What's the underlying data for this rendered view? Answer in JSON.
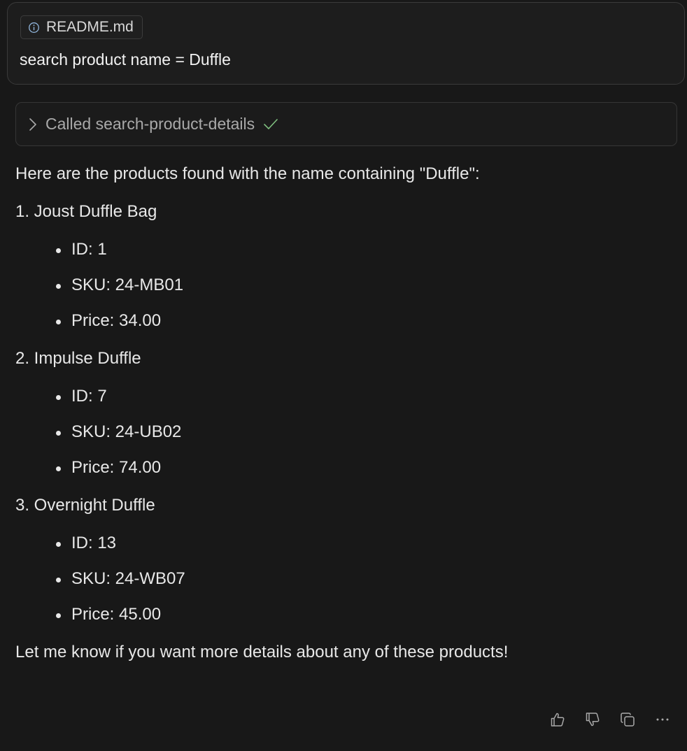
{
  "prompt": {
    "context_file": "README.md",
    "context_icon": "info-icon",
    "text": "search product name = Duffle"
  },
  "tool_call": {
    "label": "Called search-product-details",
    "status_icon": "check-icon",
    "expand_icon": "chevron-right-icon"
  },
  "response": {
    "intro": "Here are the products found with the name containing \"Duffle\":",
    "products": [
      {
        "title": "1. Joust Duffle Bag",
        "details": [
          "ID: 1",
          "SKU: 24-MB01",
          "Price: 34.00"
        ]
      },
      {
        "title": "2. Impulse Duffle",
        "details": [
          "ID: 7",
          "SKU: 24-UB02",
          "Price: 74.00"
        ]
      },
      {
        "title": "3. Overnight Duffle",
        "details": [
          "ID: 13",
          "SKU: 24-WB07",
          "Price: 45.00"
        ]
      }
    ],
    "outro": "Let me know if you want more details about any of these products!"
  },
  "actions": [
    "thumbs-up-icon",
    "thumbs-down-icon",
    "copy-icon",
    "more-icon"
  ],
  "colors": {
    "background": "#181818",
    "text": "#e8e8e8",
    "muted": "#a9a9a9",
    "success": "#7fbf7f",
    "info": "#8fb3d9"
  }
}
